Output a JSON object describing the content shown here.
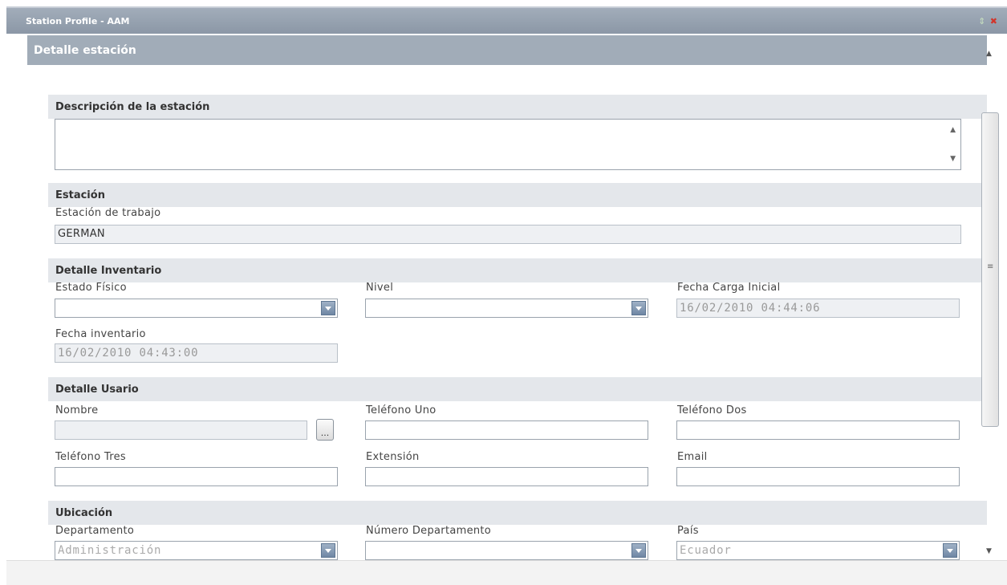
{
  "window": {
    "title": "Station Profile - AAM",
    "panel_title": "Detalle estación"
  },
  "description": {
    "section_title": "Descripción de la estación",
    "value": ""
  },
  "station": {
    "section_title": "Estación",
    "workstation_label": "Estación de trabajo",
    "workstation_value": "GERMAN"
  },
  "inventory": {
    "section_title": "Detalle Inventario",
    "estado_label": "Estado Físico",
    "estado_value": "",
    "nivel_label": "Nivel",
    "nivel_value": "",
    "fecha_carga_label": "Fecha Carga Inicial",
    "fecha_carga_value": "16/02/2010 04:44:06",
    "fecha_inv_label": "Fecha inventario",
    "fecha_inv_value": "16/02/2010 04:43:00"
  },
  "user": {
    "section_title": "Detalle Usario",
    "nombre_label": "Nombre",
    "nombre_value": "",
    "browse_label": "...",
    "tel1_label": "Teléfono Uno",
    "tel2_label": "Teléfono Dos",
    "tel3_label": "Teléfono Tres",
    "ext_label": "Extensión",
    "email_label": "Email"
  },
  "location": {
    "section_title": "Ubicación",
    "depto_label": "Departamento",
    "depto_value": "Administración",
    "num_depto_label": "Número Departamento",
    "num_depto_value": "",
    "pais_label": "País",
    "pais_value": "Ecuador"
  },
  "icons": {
    "window_controls": [
      "maximize-icon",
      "close-icon"
    ],
    "scroll": [
      "scroll-up-icon",
      "scroll-down-icon",
      "scroll-grip-icon"
    ],
    "combo": "chevron-down-icon"
  }
}
